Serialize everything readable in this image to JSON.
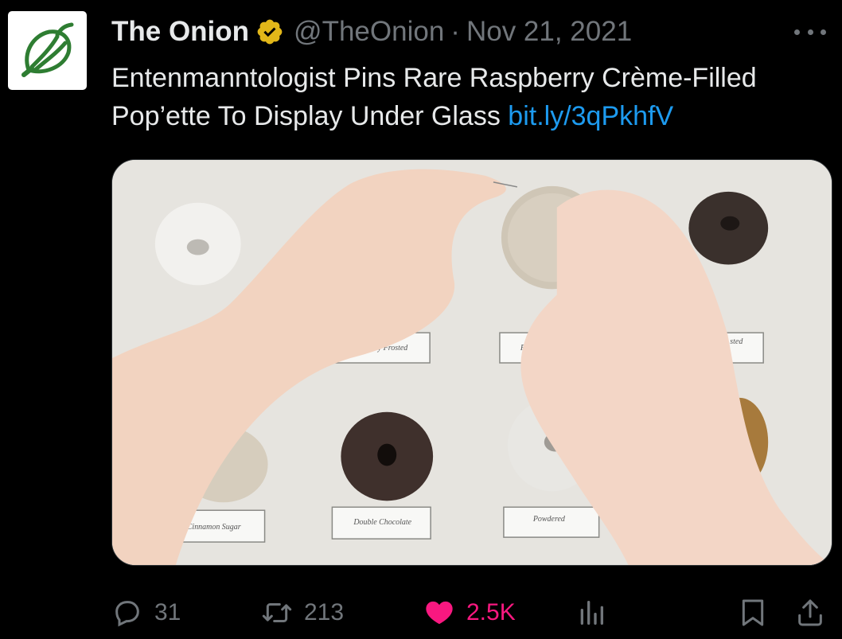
{
  "author": {
    "display_name": "The Onion",
    "handle": "@TheOnion",
    "date": "Nov 21, 2021",
    "avatar_icon": "onion-logo-icon",
    "verified_icon": "verified-gold-badge-icon"
  },
  "tweet": {
    "text": "Entenmanntologist Pins Rare Raspberry Crème-Filled Pop’ette To Display Under Glass",
    "link": "bit.ly/3qPkhfV"
  },
  "media": {
    "labels": [
      "Strawberry Frosted",
      "Raspbe",
      "sted",
      "Cinnamon Sugar",
      "Double Chocolate",
      "Powdered"
    ]
  },
  "actions": {
    "reply_count": "31",
    "retweet_count": "213",
    "like_count": "2.5K",
    "views_label": "",
    "icons": [
      "reply-icon",
      "retweet-icon",
      "heart-icon",
      "views-icon",
      "bookmark-icon",
      "share-icon"
    ]
  },
  "colors": {
    "background": "#000000",
    "link": "#1d9bf0",
    "muted": "#71767b",
    "like": "#f91880",
    "verified": "#e2b719",
    "brand_green": "#2e7d32"
  }
}
